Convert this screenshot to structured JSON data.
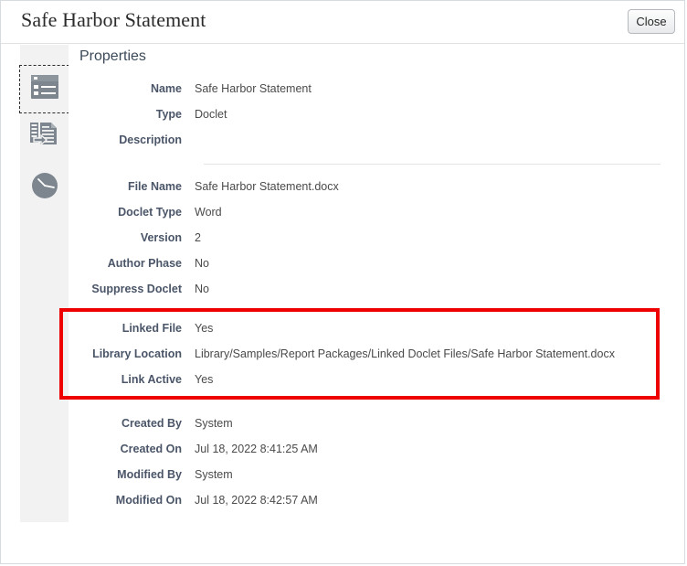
{
  "header": {
    "title": "Safe Harbor Statement",
    "close_label": "Close"
  },
  "sidebar": {
    "items": [
      {
        "name": "properties",
        "icon": "properties-icon",
        "selected": true
      },
      {
        "name": "variables",
        "icon": "variables-icon",
        "selected": false
      },
      {
        "name": "history",
        "icon": "history-clock-icon",
        "selected": false
      }
    ]
  },
  "main": {
    "section_title": "Properties",
    "groups": [
      {
        "id": "identity",
        "fields": [
          {
            "label": "Name",
            "value": "Safe Harbor Statement"
          },
          {
            "label": "Type",
            "value": "Doclet"
          },
          {
            "label": "Description",
            "value": ""
          }
        ]
      },
      {
        "id": "file",
        "fields": [
          {
            "label": "File Name",
            "value": "Safe Harbor Statement.docx"
          },
          {
            "label": "Doclet Type",
            "value": "Word"
          },
          {
            "label": "Version",
            "value": "2"
          },
          {
            "label": "Author Phase",
            "value": "No"
          },
          {
            "label": "Suppress Doclet",
            "value": "No"
          }
        ]
      },
      {
        "id": "link",
        "highlighted": true,
        "highlight_color": "#ee0000",
        "fields": [
          {
            "label": "Linked File",
            "value": "Yes"
          },
          {
            "label": "Library Location",
            "value": "Library/Samples/Report Packages/Linked Doclet Files/Safe Harbor Statement.docx"
          },
          {
            "label": "Link Active",
            "value": "Yes"
          }
        ]
      },
      {
        "id": "audit",
        "fields": [
          {
            "label": "Created By",
            "value": "System"
          },
          {
            "label": "Created On",
            "value": "Jul 18, 2022 8:41:25 AM"
          },
          {
            "label": "Modified By",
            "value": "System"
          },
          {
            "label": "Modified On",
            "value": "Jul 18, 2022 8:42:57 AM"
          }
        ]
      }
    ]
  }
}
